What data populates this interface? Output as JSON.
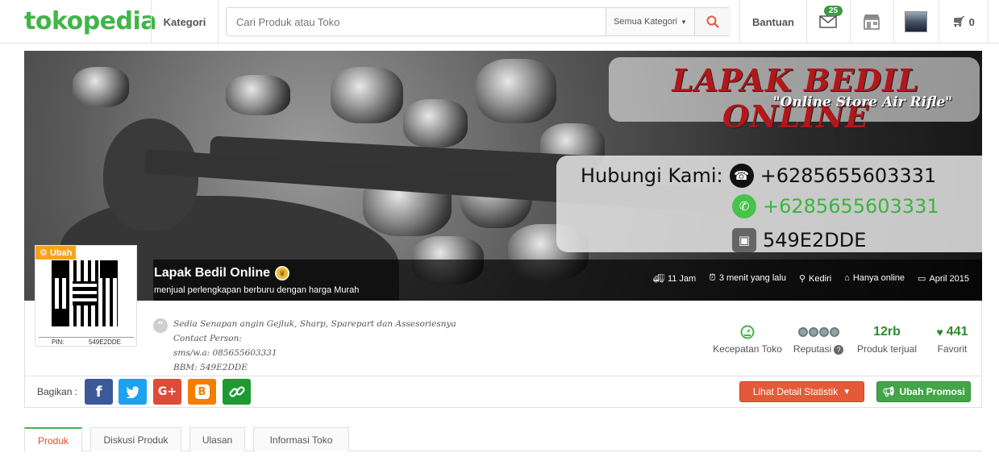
{
  "header": {
    "logo": "tokopedia",
    "kategori_label": "Kategori",
    "search_placeholder": "Cari Produk atau Toko",
    "search_category": "Semua Kategori",
    "bantuan_label": "Bantuan",
    "message_count": "25",
    "cart_count": "0"
  },
  "banner": {
    "brand_title": "LAPAK BEDIL ONLINE",
    "brand_subtitle": "\"Online Store Air Rifle\"",
    "contact_label": "Hubungi Kami:",
    "phone": "+6285655603331",
    "whatsapp": "+6285655603331",
    "bbm": "549E2DDE"
  },
  "shop": {
    "name": "Lapak Bedil Online",
    "tagline": "menjual perlengkapan berburu dengan harga Murah",
    "meta": {
      "response": "11 Jam",
      "last_online": "3 menit yang lalu",
      "location": "Kediri",
      "schedule": "Hanya online",
      "since": "April 2015"
    },
    "qr_edit_label": "Ubah",
    "pin_label": "PIN:",
    "pin_value": "549E2DDE",
    "description": [
      "Sedia Senapan angin Gejluk, Sharp, Sparepart dan Assesoriesnya",
      "Contact Person:",
      "sms/w.a: 085655603331",
      "BBM: 549E2DDE"
    ]
  },
  "stats": {
    "speed_label": "Kecepatan Toko",
    "reputation_label": "Reputasi",
    "sold_value": "12rb",
    "sold_label": "Produk terjual",
    "favorite_value": "441",
    "favorite_label": "Favorit"
  },
  "actions": {
    "share_label": "Bagikan :",
    "detail_button": "Lihat Detail Statistik",
    "promo_button": "Ubah Promosi"
  },
  "tabs": [
    {
      "label": "Produk"
    },
    {
      "label": "Diskusi Produk"
    },
    {
      "label": "Ulasan"
    },
    {
      "label": "Informasi Toko"
    }
  ],
  "colors": {
    "brand_green": "#42b549",
    "detail_orange": "#e45a39",
    "promo_green": "#42a548",
    "banner_red": "#b3171a"
  }
}
